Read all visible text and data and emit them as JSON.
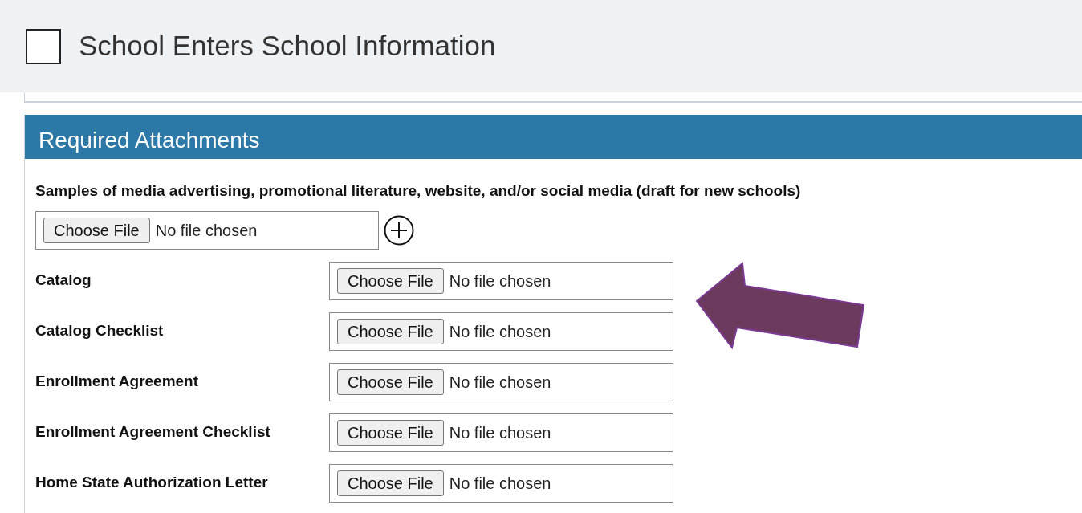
{
  "header": {
    "checkbox": {
      "checked": false
    },
    "title": "School Enters School Information"
  },
  "section": {
    "title": "Required Attachments",
    "primary_attachment": {
      "label": "Samples of media advertising, promotional literature, website, and/or social media (draft for new schools)",
      "button": "Choose File",
      "status": "No file chosen"
    },
    "attachments": [
      {
        "label": "Catalog",
        "button": "Choose File",
        "status": "No file chosen"
      },
      {
        "label": "Catalog Checklist",
        "button": "Choose File",
        "status": "No file chosen"
      },
      {
        "label": "Enrollment Agreement",
        "button": "Choose File",
        "status": "No file chosen"
      },
      {
        "label": "Enrollment Agreement Checklist",
        "button": "Choose File",
        "status": "No file chosen"
      },
      {
        "label": "Home State Authorization Letter",
        "button": "Choose File",
        "status": "No file chosen"
      }
    ]
  },
  "callout_arrow": {
    "color": "#6b3a5c"
  }
}
